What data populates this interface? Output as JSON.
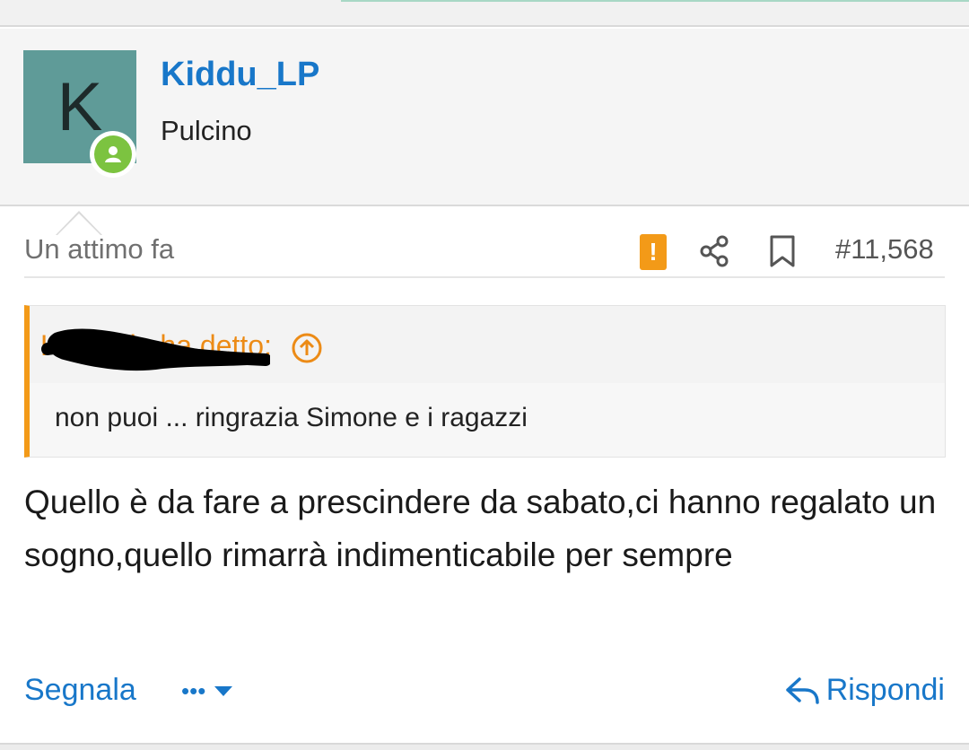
{
  "author": {
    "avatar_letter": "K",
    "username": "Kiddu_LP",
    "title": "Pulcino",
    "status_icon": "user-online-icon"
  },
  "post": {
    "timestamp": "Un attimo fa",
    "post_number": "#11,568",
    "report_flag": "!",
    "icons": [
      "share-icon",
      "bookmark-icon"
    ],
    "quote": {
      "author_visible": "Kazan ie ha detto:",
      "text": "non puoi ... ringrazia Simone e i ragazzi"
    },
    "body": "Quello è da fare a prescindere da sabato,ci hanno regalato un sogno,quello rimarrà indimenticabile per sempre"
  },
  "actions": {
    "report_label": "Segnala",
    "more_label": "•••",
    "reply_label": "Rispondi"
  },
  "colors": {
    "link": "#1877c9",
    "quote_accent": "#f39a18",
    "avatar_bg": "#5f9b98",
    "online": "#7cc340"
  }
}
